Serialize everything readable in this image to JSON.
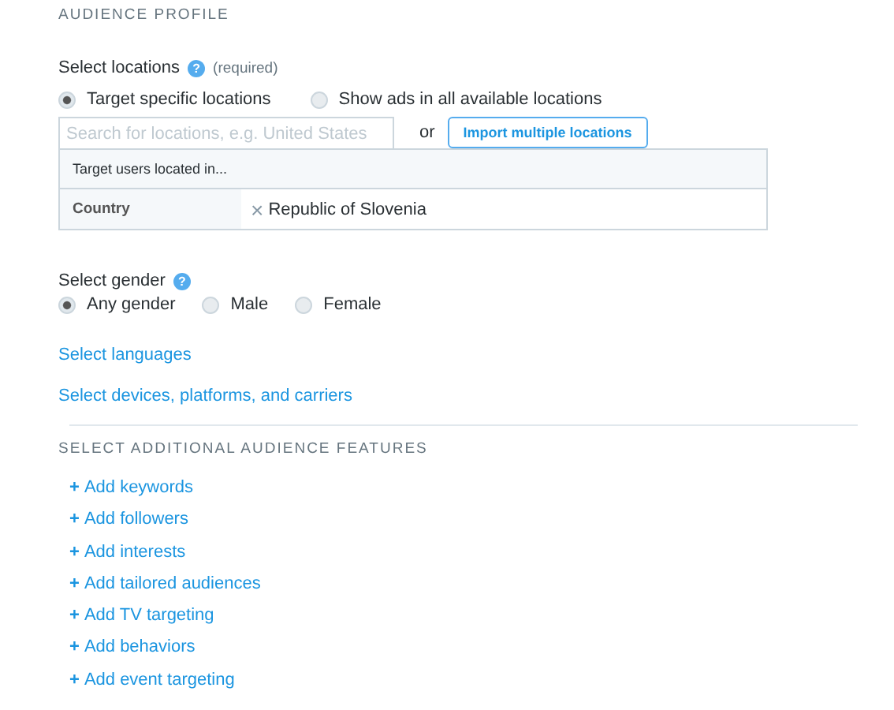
{
  "title": "AUDIENCE PROFILE",
  "locations": {
    "label": "Select locations",
    "help": "?",
    "note": "(required)",
    "options": [
      {
        "label": "Target specific locations",
        "selected": true
      },
      {
        "label": "Show ads in all available locations",
        "selected": false
      }
    ],
    "search": {
      "placeholder": "Search for locations, e.g. United States"
    },
    "or": "or",
    "import_button": "Import multiple locations",
    "table": {
      "header": "Target users located in...",
      "rows": [
        {
          "type": "Country",
          "value": "Republic of Slovenia",
          "remove": "×"
        }
      ]
    }
  },
  "gender": {
    "label": "Select gender",
    "help": "?",
    "options": [
      {
        "label": "Any gender",
        "selected": true
      },
      {
        "label": "Male",
        "selected": false
      },
      {
        "label": "Female",
        "selected": false
      }
    ]
  },
  "links": [
    "Select languages",
    "Select devices, platforms, and carriers"
  ],
  "features": {
    "title": "SELECT ADDITIONAL AUDIENCE FEATURES",
    "items": [
      {
        "icon": "+",
        "label": "Add keywords"
      },
      {
        "icon": "+",
        "label": "Add followers"
      },
      {
        "icon": "+",
        "label": "Add interests"
      },
      {
        "icon": "+",
        "label": "Add tailored audiences"
      },
      {
        "icon": "+",
        "label": "Add TV targeting"
      },
      {
        "icon": "+",
        "label": "Add behaviors"
      },
      {
        "icon": "+",
        "label": "Add event targeting"
      }
    ]
  }
}
